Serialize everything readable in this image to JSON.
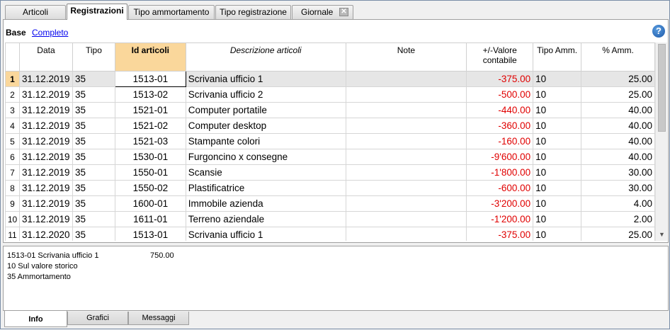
{
  "tabs": [
    {
      "label": "Articoli"
    },
    {
      "label": "Registrazioni"
    },
    {
      "label": "Tipo ammortamento"
    },
    {
      "label": "Tipo registrazione"
    },
    {
      "label": "Giornale"
    }
  ],
  "view": {
    "base_label": "Base",
    "full_link": "Completo",
    "help": "?"
  },
  "columns": {
    "data": "Data",
    "tipo": "Tipo",
    "id": "Id articoli",
    "descrizione": "Descrizione articoli",
    "note": "Note",
    "valore": "+/-Valore contabile",
    "tipo_amm": "Tipo Amm.",
    "perc_amm": "% Amm."
  },
  "rows": [
    {
      "n": "1",
      "data": "31.12.2019",
      "tipo": "35",
      "id": "1513-01",
      "desc": "Scrivania ufficio 1",
      "note": "",
      "valore": "-375.00",
      "tipo_amm": "10",
      "perc": "25.00"
    },
    {
      "n": "2",
      "data": "31.12.2019",
      "tipo": "35",
      "id": "1513-02",
      "desc": "Scrivania ufficio 2",
      "note": "",
      "valore": "-500.00",
      "tipo_amm": "10",
      "perc": "25.00"
    },
    {
      "n": "3",
      "data": "31.12.2019",
      "tipo": "35",
      "id": "1521-01",
      "desc": "Computer portatile",
      "note": "",
      "valore": "-440.00",
      "tipo_amm": "10",
      "perc": "40.00"
    },
    {
      "n": "4",
      "data": "31.12.2019",
      "tipo": "35",
      "id": "1521-02",
      "desc": "Computer desktop",
      "note": "",
      "valore": "-360.00",
      "tipo_amm": "10",
      "perc": "40.00"
    },
    {
      "n": "5",
      "data": "31.12.2019",
      "tipo": "35",
      "id": "1521-03",
      "desc": "Stampante colori",
      "note": "",
      "valore": "-160.00",
      "tipo_amm": "10",
      "perc": "40.00"
    },
    {
      "n": "6",
      "data": "31.12.2019",
      "tipo": "35",
      "id": "1530-01",
      "desc": "Furgoncino x consegne",
      "note": "",
      "valore": "-9'600.00",
      "tipo_amm": "10",
      "perc": "40.00"
    },
    {
      "n": "7",
      "data": "31.12.2019",
      "tipo": "35",
      "id": "1550-01",
      "desc": "Scansie",
      "note": "",
      "valore": "-1'800.00",
      "tipo_amm": "10",
      "perc": "30.00"
    },
    {
      "n": "8",
      "data": "31.12.2019",
      "tipo": "35",
      "id": "1550-02",
      "desc": "Plastificatrice",
      "note": "",
      "valore": "-600.00",
      "tipo_amm": "10",
      "perc": "30.00"
    },
    {
      "n": "9",
      "data": "31.12.2019",
      "tipo": "35",
      "id": "1600-01",
      "desc": "Immobile azienda",
      "note": "",
      "valore": "-3'200.00",
      "tipo_amm": "10",
      "perc": "4.00"
    },
    {
      "n": "10",
      "data": "31.12.2019",
      "tipo": "35",
      "id": "1611-01",
      "desc": "Terreno aziendale",
      "note": "",
      "valore": "-1'200.00",
      "tipo_amm": "10",
      "perc": "2.00"
    },
    {
      "n": "11",
      "data": "31.12.2020",
      "tipo": "35",
      "id": "1513-01",
      "desc": "Scrivania ufficio 1",
      "note": "",
      "valore": "-375.00",
      "tipo_amm": "10",
      "perc": "25.00"
    }
  ],
  "info": {
    "line1": "1513-01 Scrivania ufficio 1",
    "amount": "750.00",
    "line2": "10 Sul valore storico",
    "line3": "35 Ammortamento"
  },
  "bottom_tabs": [
    {
      "label": "Info"
    },
    {
      "label": "Grafici"
    },
    {
      "label": "Messaggi"
    }
  ],
  "colors": {
    "negative": "#e00000",
    "selected_header": "#fad79b",
    "link": "#0000ee"
  },
  "icons": {
    "close_tab": "close-icon",
    "help": "help-icon",
    "scroll_down": "chevron-down-icon"
  }
}
